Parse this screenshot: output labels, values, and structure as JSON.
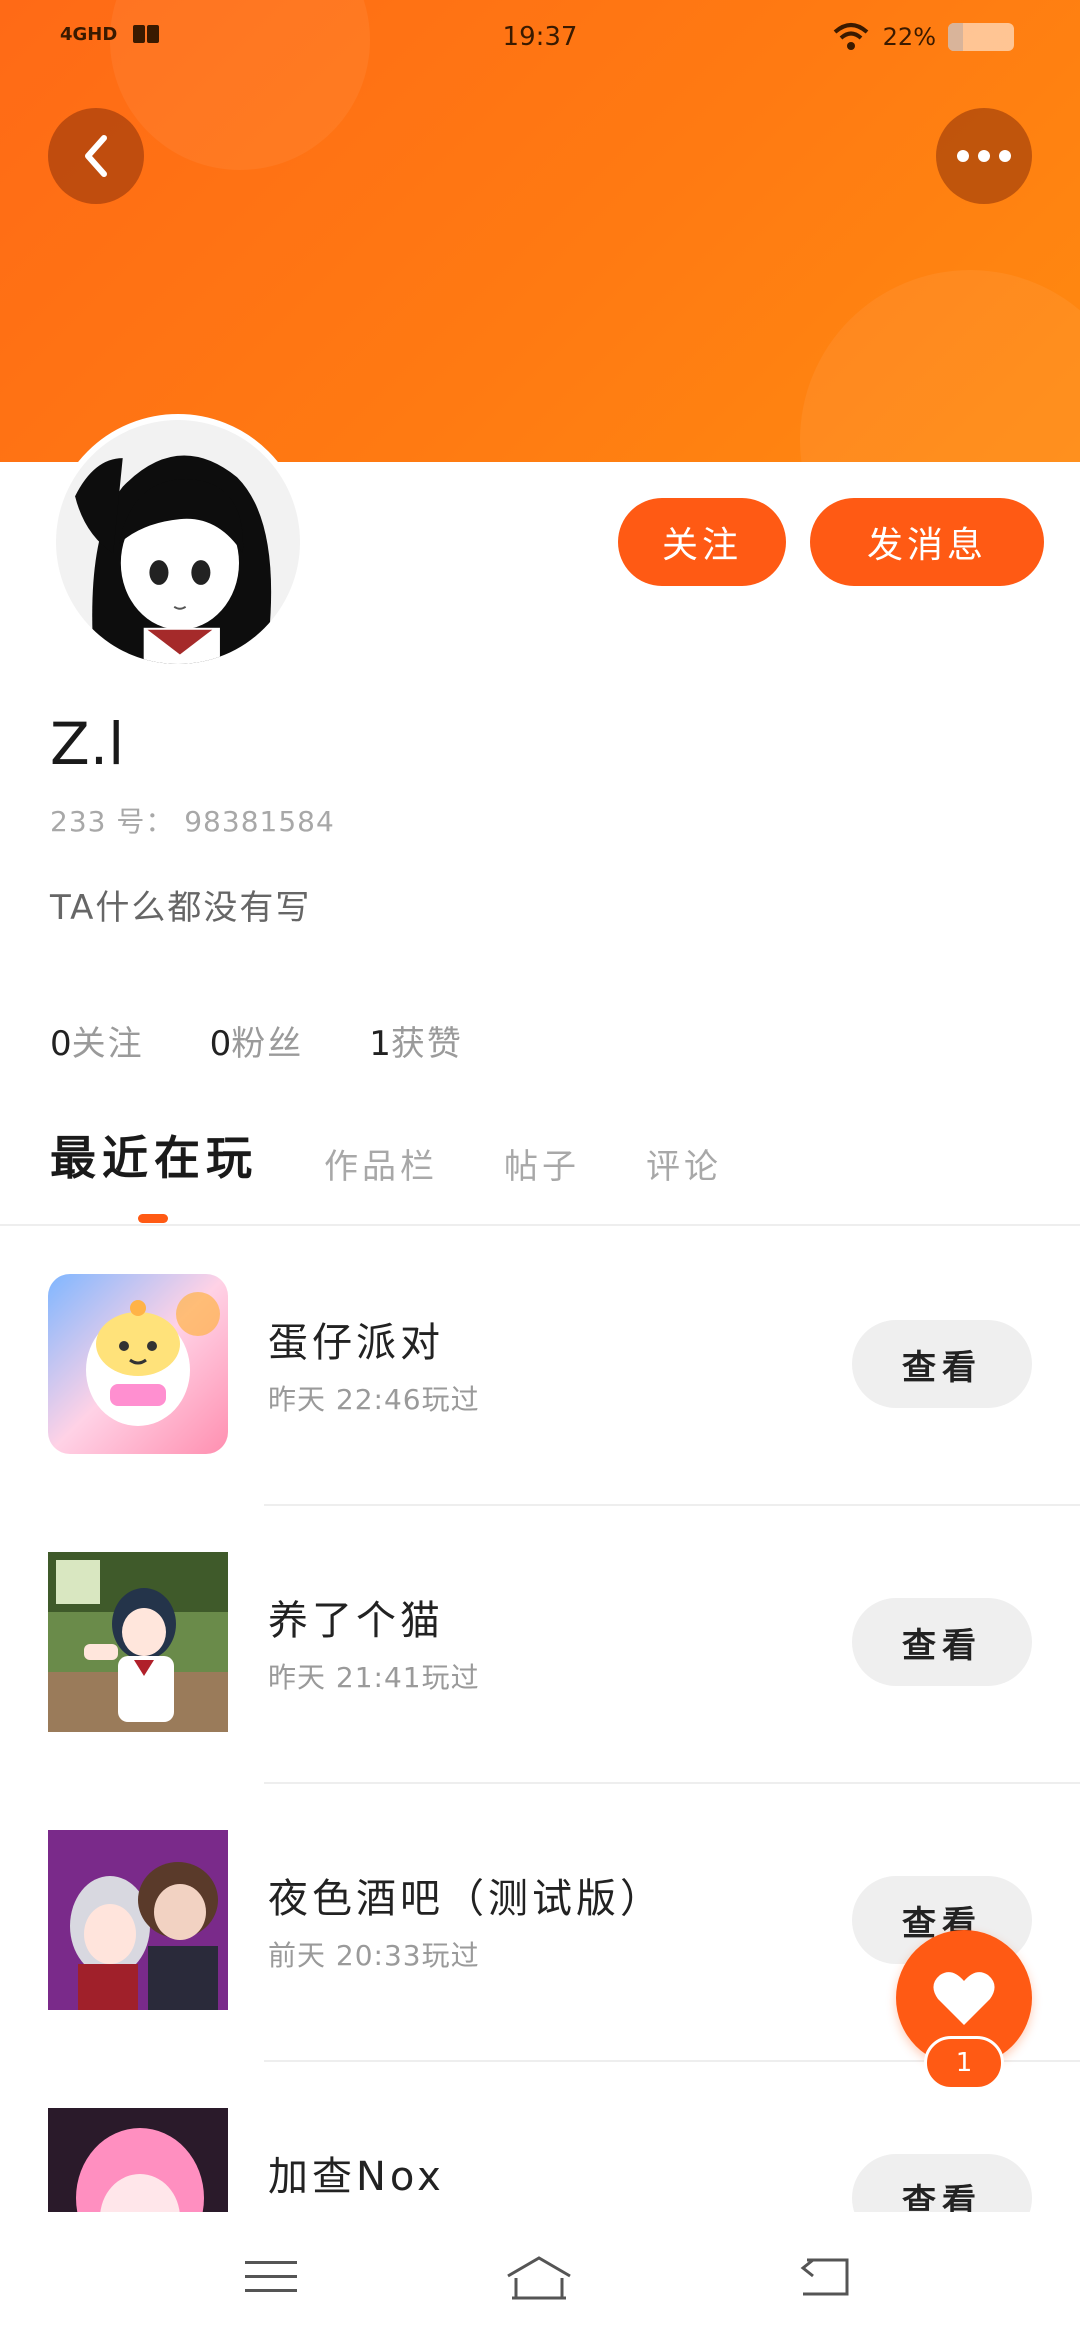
{
  "status_bar": {
    "network": "4GHD",
    "time": "19:37",
    "battery_text": "22%",
    "battery_level": 0.22
  },
  "header": {
    "back_icon": "chevron-left-icon",
    "more_icon": "more-dots-icon"
  },
  "profile": {
    "nickname": "Z.l",
    "uid": "233 号： 98381584",
    "bio": "TA什么都没有写",
    "follow_label": "关注",
    "message_label": "发消息",
    "stats": [
      {
        "num": "0",
        "label": "关注"
      },
      {
        "num": "0",
        "label": "粉丝"
      },
      {
        "num": "1",
        "label": "获赞"
      }
    ]
  },
  "tabs": [
    {
      "label": "最近在玩",
      "active": true
    },
    {
      "label": "作品栏",
      "active": false
    },
    {
      "label": "帖子",
      "active": false
    },
    {
      "label": "评论",
      "active": false
    }
  ],
  "games": [
    {
      "title": "蛋仔派对",
      "time": "昨天 22:46玩过",
      "button": "查看"
    },
    {
      "title": "养了个猫",
      "time": "昨天 21:41玩过",
      "button": "查看"
    },
    {
      "title": "夜色酒吧（测试版）",
      "time": "前天 20:33玩过",
      "button": "查看"
    },
    {
      "title": "加查Nox",
      "time": "",
      "button": "查看"
    }
  ],
  "floating_like": {
    "count": "1",
    "icon": "heart-icon"
  },
  "nav_bar": {
    "icons": [
      "menu-icon",
      "home-icon",
      "back-icon"
    ]
  },
  "colors": {
    "accent": "#ff5a14",
    "banner": "#ff7a12"
  }
}
